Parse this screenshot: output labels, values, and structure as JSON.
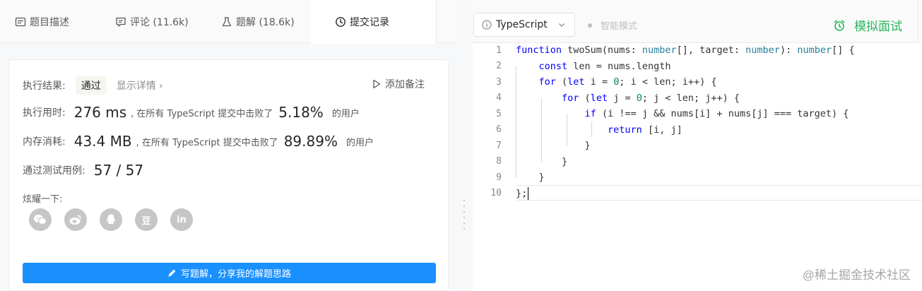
{
  "tabs": {
    "description": "题目描述",
    "comments": "评论 (11.6k)",
    "solutions": "题解 (18.6k)",
    "submissions": "提交记录"
  },
  "result": {
    "label": "执行结果:",
    "status": "通过",
    "details_link": "显示详情 ›",
    "add_note": "添加备注",
    "runtime_label": "执行用时:",
    "runtime_value": "276 ms",
    "runtime_mid": ", 在所有 TypeScript 提交中击败了",
    "runtime_pct": "5.18%",
    "runtime_users": "的用户",
    "memory_label": "内存消耗:",
    "memory_value": "43.4 MB",
    "memory_mid": ", 在所有 TypeScript 提交中击败了",
    "memory_pct": "89.89%",
    "memory_users": "的用户",
    "tests_label": "通过测试用例:",
    "tests_value": "57 / 57",
    "share_label": "炫耀一下:",
    "socials": [
      "wechat-icon",
      "weibo-icon",
      "qq-icon",
      "douban-icon",
      "linkedin-icon"
    ],
    "douban_glyph": "豆",
    "linkedin_glyph": "in",
    "write_button": "写题解，分享我的解题思路"
  },
  "toolbar": {
    "language": "TypeScript",
    "smart_mode": "智能模式",
    "mock_interview": "模拟面试"
  },
  "editor": {
    "line_numbers": [
      "1",
      "2",
      "3",
      "4",
      "5",
      "6",
      "7",
      "8",
      "9",
      "10"
    ]
  },
  "watermark": "@稀土掘金技术社区",
  "colors": {
    "accent_blue": "#1a90ff",
    "success_green": "#2db55d",
    "keyword": "#0000ff",
    "type": "#267f99",
    "number": "#098658"
  }
}
